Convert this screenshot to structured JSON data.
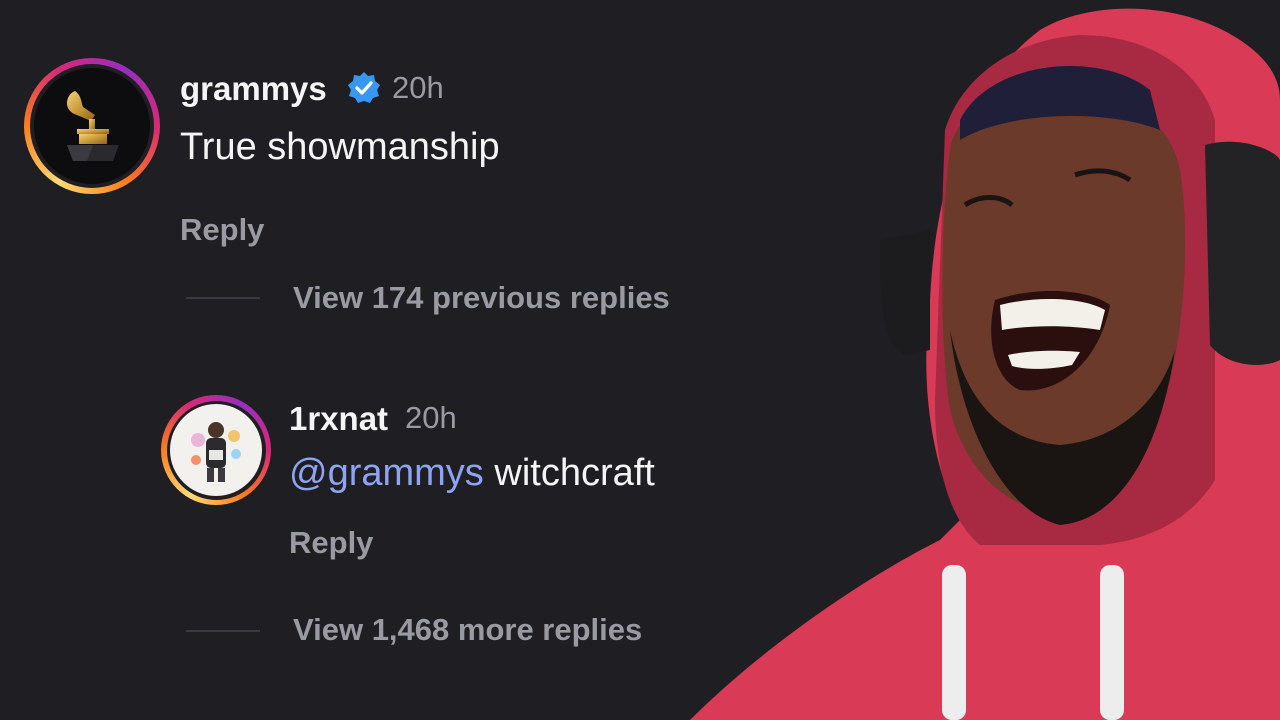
{
  "comments": [
    {
      "username": "grammys",
      "verified": true,
      "time": "20h",
      "text": "True showmanship",
      "reply_label": "Reply",
      "view_replies": "View 174 previous replies"
    },
    {
      "username": "1rxnat",
      "verified": false,
      "time": "20h",
      "mention": "@grammys",
      "text": " witchcraft",
      "reply_label": "Reply",
      "view_replies": "View 1,468 more replies"
    }
  ],
  "colors": {
    "background": "#1f1f23",
    "mention": "#8ea4f2",
    "verified": "#3897f0",
    "muted_text": "#9a9aa3",
    "hoodie": "#d93a56"
  },
  "icons": {
    "grammys_avatar": "gramophone-trophy-icon",
    "verified": "verified-badge-icon",
    "user_avatar": "cartoon-avatar-icon"
  }
}
